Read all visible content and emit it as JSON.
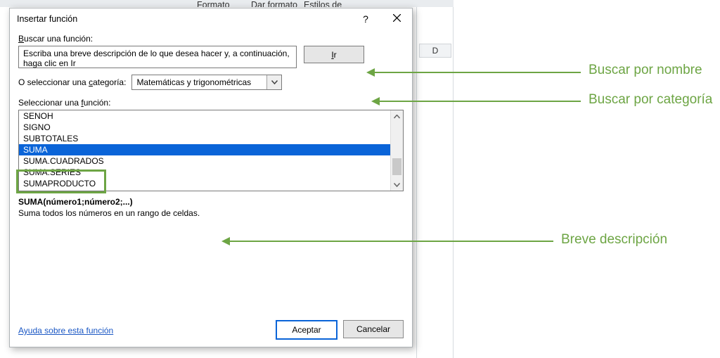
{
  "bg": {
    "menu_formato": "Formato",
    "menu_dar_formato": "Dar formato",
    "menu_estilos": "Estilos de",
    "col_header_d": "D"
  },
  "dialog": {
    "title": "Insertar función",
    "help_symbol": "?",
    "search_label_pre": "B",
    "search_label_rest": "uscar una función:",
    "search_text": "Escriba una breve descripción de lo que desea hacer y, a continuación, haga clic en Ir",
    "btn_ir_pre": "I",
    "btn_ir_rest": "r",
    "cat_label_pre": "O seleccionar una ",
    "cat_label_u": "c",
    "cat_label_post": "ategoría:",
    "cat_value": "Matemáticas y trigonométricas",
    "sel_label_pre": "Seleccionar una ",
    "sel_label_u": "f",
    "sel_label_post": "unción:",
    "list": {
      "i0": "SENOH",
      "i1": "SIGNO",
      "i2": "SUBTOTALES",
      "i3": "SUMA",
      "i4": "SUMA.CUADRADOS",
      "i5": "SUMA.SERIES",
      "i6": "SUMAPRODUCTO"
    },
    "syntax": "SUMA(número1;número2;...)",
    "description": "Suma todos los números en un rango de celdas.",
    "help_link": "Ayuda sobre esta función",
    "btn_ok": "Aceptar",
    "btn_cancel": "Cancelar"
  },
  "annotations": {
    "a1": "Buscar por nombre",
    "a2": "Buscar por categoría",
    "a3": "Breve descripción"
  }
}
